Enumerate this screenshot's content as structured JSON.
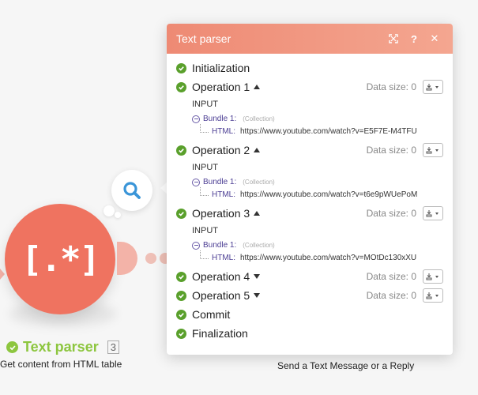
{
  "panel": {
    "title": "Text parser",
    "accent_start": "#ee8a74",
    "accent_end": "#f4a690",
    "icons": [
      "expand-icon",
      "help-icon",
      "close-icon"
    ]
  },
  "steps": {
    "initialization": "Initialization",
    "op1": {
      "label": "Operation 1",
      "data_size": "Data size: 0",
      "input_label": "INPUT",
      "bundle": "Bundle 1:",
      "collection": "(Collection)",
      "key": "HTML:",
      "value": "https://www.youtube.com/watch?v=E5F7E-M4TFU"
    },
    "op2": {
      "label": "Operation 2",
      "data_size": "Data size: 0",
      "input_label": "INPUT",
      "bundle": "Bundle 1:",
      "collection": "(Collection)",
      "key": "HTML:",
      "value": "https://www.youtube.com/watch?v=t6e9pWUePoM"
    },
    "op3": {
      "label": "Operation 3",
      "data_size": "Data size: 0",
      "input_label": "INPUT",
      "bundle": "Bundle 1:",
      "collection": "(Collection)",
      "key": "HTML:",
      "value": "https://www.youtube.com/watch?v=MOtDc130xXU"
    },
    "op4": {
      "label": "Operation 4",
      "data_size": "Data size: 0"
    },
    "op5": {
      "label": "Operation 5",
      "data_size": "Data size: 0"
    },
    "commit": "Commit",
    "finalization": "Finalization"
  },
  "module": {
    "glyph": "[.*]",
    "title": "Text parser",
    "badge": "3",
    "subtitle": "Get content from HTML table",
    "color": "#ef7360",
    "status_color": "#8dc63f"
  },
  "next_module": {
    "subtitle": "Send a Text Message or a Reply"
  },
  "colors": {
    "success": "#5aa02c",
    "bundle": "#4b3d93"
  }
}
